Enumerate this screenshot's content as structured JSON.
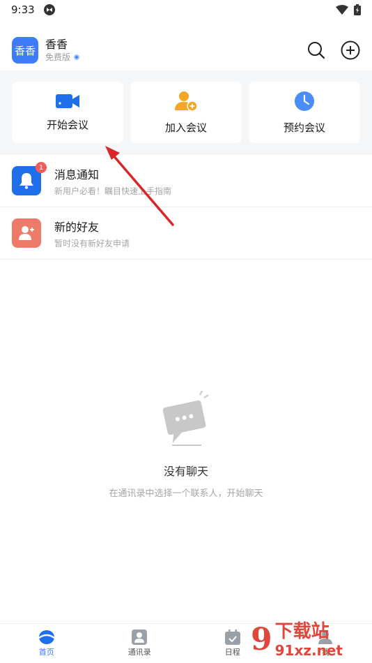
{
  "status_bar": {
    "time": "9:33"
  },
  "header": {
    "avatar_text": "香香",
    "user_name": "香香",
    "plan": "免费版",
    "actions": [
      "search-icon",
      "add-circle-icon"
    ]
  },
  "meeting_actions": [
    {
      "label": "开始会议",
      "icon": "video-camera-icon",
      "color": "#1f6feb"
    },
    {
      "label": "加入会议",
      "icon": "add-person-icon",
      "color": "#f5a623"
    },
    {
      "label": "预约会议",
      "icon": "clock-icon",
      "color": "#4a8ef5"
    }
  ],
  "list": [
    {
      "title": "消息通知",
      "subtitle": "新用户必看！瞩目快速上手指南",
      "badge": "1",
      "icon": "bell-icon",
      "color": "#1f6feb"
    },
    {
      "title": "新的好友",
      "subtitle": "暂时没有新好友申请",
      "icon": "add-friend-icon",
      "color": "#ee7b6a"
    }
  ],
  "empty_state": {
    "title": "没有聊天",
    "subtitle": "在通讯录中选择一个联系人，开始聊天"
  },
  "tabbar": {
    "tabs": [
      {
        "label": "首页",
        "active": true
      },
      {
        "label": "通讯录",
        "active": false
      },
      {
        "label": "日程",
        "active": false
      },
      {
        "label": "我",
        "active": false
      }
    ]
  },
  "watermark": {
    "logo": "9",
    "title": "下载站",
    "url": "91xz.net"
  },
  "colors": {
    "accent": "#3e7bf6",
    "annotation_arrow": "#d9262b"
  }
}
